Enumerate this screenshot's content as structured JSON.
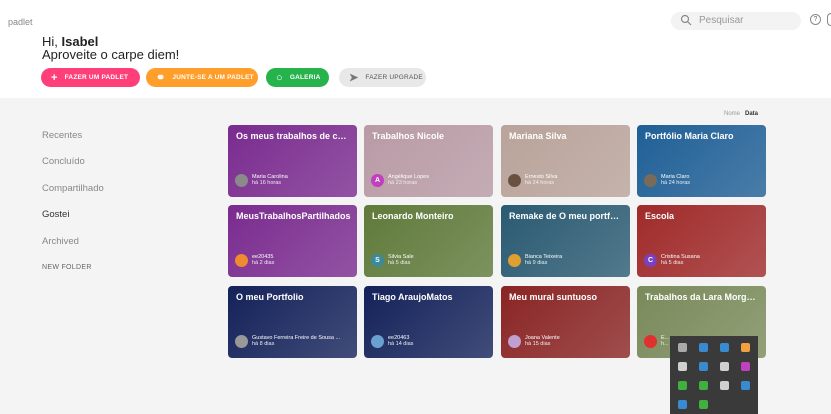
{
  "header": {
    "logo": "padlet",
    "greeting_prefix": "Hi, ",
    "user_name": "Isabel",
    "tagline": "Aproveite o carpe diem!",
    "search_placeholder": "Pesquisar",
    "help_icon": "?"
  },
  "actions": {
    "make_padlet": "FAZER UM PADLET",
    "join_padlet": "JUNTE-SE A UM PADLET",
    "gallery": "GALERIA",
    "upgrade": "FAZER UPGRADE"
  },
  "sort": {
    "name": "Nome",
    "date": "Data"
  },
  "sidebar": {
    "items": [
      {
        "label": "Recentes"
      },
      {
        "label": "Concluído"
      },
      {
        "label": "Compartilhado"
      },
      {
        "label": "Gostei"
      },
      {
        "label": "Archived"
      }
    ],
    "new_folder": "NEW FOLDER"
  },
  "cards": [
    {
      "title": "Os meus trabalhos de casa",
      "owner": "Maria Carolina",
      "time": "há 16 horas",
      "avatar": "",
      "bg": "#7a2b8f",
      "avatar_color": "#8a8a8a"
    },
    {
      "title": "Trabalhos Nicole",
      "owner": "Angélique Lopes",
      "time": "há 23 horas",
      "avatar": "A",
      "bg": "#b89aa5",
      "avatar_color": "#c040c0"
    },
    {
      "title": "Mariana Silva",
      "owner": "Ernesto Silva",
      "time": "há 24 horas",
      "avatar": "",
      "bg": "#b9a39a",
      "avatar_color": "#6a5040"
    },
    {
      "title": "Portfólio Maria Claro",
      "owner": "Maria Claro",
      "time": "há 24 horas",
      "avatar": "",
      "bg": "#1f5f96",
      "avatar_color": "#7a6a5a"
    },
    {
      "title": "MeusTrabalhosPartilhados",
      "owner": "ee20435",
      "time": "há 2 dias",
      "avatar": "",
      "bg": "#7a2b8f",
      "avatar_color": "#f08a30"
    },
    {
      "title": "Leonardo Monteiro",
      "owner": "Silvia Sale",
      "time": "há 5 dias",
      "avatar": "S",
      "bg": "#5f7a3a",
      "avatar_color": "#3a8a9a"
    },
    {
      "title": "Remake de O meu portfólio",
      "owner": "Bianca Teixeira",
      "time": "há 9 dias",
      "avatar": "",
      "bg": "#2a5a72",
      "avatar_color": "#e0a030"
    },
    {
      "title": "Escola",
      "owner": "Cristina Susana",
      "time": "há 5 dias",
      "avatar": "C",
      "bg": "#a02a2a",
      "avatar_color": "#7a40c0"
    },
    {
      "title": "O meu Portfolio",
      "owner": "Gustavo Ferreira Freire de Sousa ...",
      "time": "há 8 dias",
      "avatar": "",
      "bg": "#14225a",
      "avatar_color": "#999999"
    },
    {
      "title": "Tiago AraujoMatos",
      "owner": "ee20463",
      "time": "há 14 dias",
      "avatar": "",
      "bg": "#14225a",
      "avatar_color": "#6aa0d0"
    },
    {
      "title": "Meu mural suntuoso",
      "owner": "Joana Valente",
      "time": "há 15 dias",
      "avatar": "",
      "bg": "#8a2424",
      "avatar_color": "#c0a0d0"
    },
    {
      "title": "Trabalhos da Lara Morgado",
      "owner": "E...",
      "time": "h...",
      "avatar": "",
      "bg": "#7a8a5a",
      "avatar_color": "#e03030"
    }
  ],
  "colors": {
    "make": "#ff3f7a",
    "join": "#ff9e2b",
    "gallery": "#27b34b",
    "upgrade": "#e8e8e8",
    "background": "#f4f4f4"
  },
  "tray": {
    "icons": [
      "app-icon",
      "app-icon",
      "bluetooth-icon",
      "app-icon",
      "app-icon",
      "app-icon",
      "app-icon",
      "app-icon",
      "app-icon",
      "app-icon",
      "app-icon",
      "app-icon",
      "app-icon",
      "app-icon"
    ]
  }
}
